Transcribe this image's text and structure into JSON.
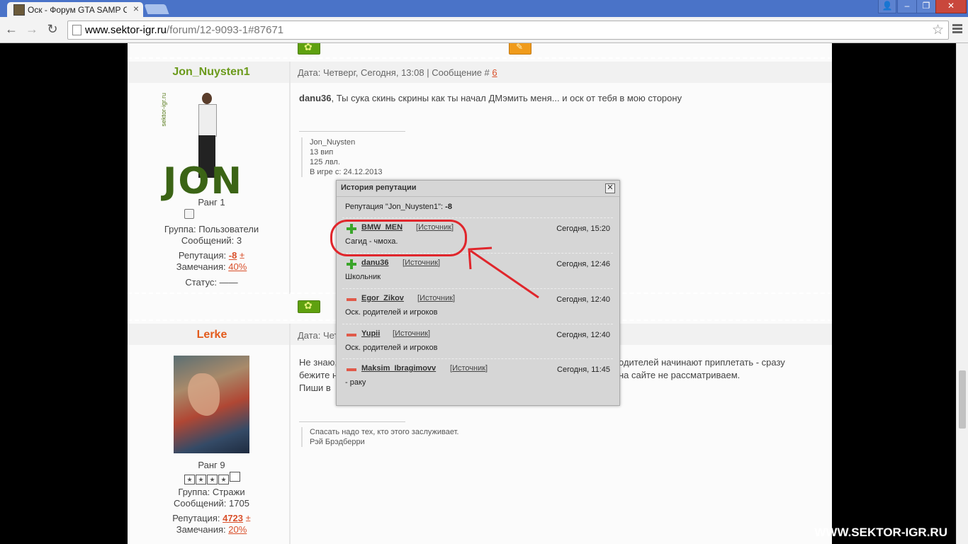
{
  "browser": {
    "tab_title": "Оск - Форум GTA SAMP С",
    "url_domain": "www.sektor-igr.ru",
    "url_path": "/forum/12-9093-1#87671"
  },
  "post1": {
    "username": "Jon_Nuysten1",
    "header": "Дата: Четверг, Сегодня, 13:08 | Сообщение # ",
    "post_number": "6",
    "avatar_side_text": "sektor-igr.ru",
    "avatar_logo": "JON",
    "rank": "Ранг 1",
    "group": "Группа: Пользователи",
    "messages": "Сообщений: 3",
    "rep_label": "Репутация: ",
    "rep_value": "-8",
    "rep_pm": "±",
    "warn_label": "Замечания: ",
    "warn_value": "40%",
    "status": "Статус: ——",
    "text_user": "danu36",
    "text": ", Ты сука скинь скрины как ты начал ДМэмить меня... и оск от тебя в мою сторону",
    "sig": [
      "Jon_Nuysten",
      "13 вип",
      "125 лвл.",
      "В игре с: 24.12.2013"
    ]
  },
  "post2": {
    "username": "Lerke",
    "header": "Дата: Чет",
    "rank": "Ранг 9",
    "group": "Группа: Стражи",
    "messages": "Сообщений: 1705",
    "rep_label": "Репутация: ",
    "rep_value": "4723",
    "rep_pm": "±",
    "warn_label": "Замечания: ",
    "warn_value": "20%",
    "text_line1_left": "Не знаю,",
    "text_line1_right": "одителей начинают приплетать - сразу",
    "text_line2_left": "бежите н",
    "text_line2_right": "на сайте не рассматриваем.",
    "text_line3_left": "Пиши в",
    "sig": [
      "Спасать надо тех, кто этого заслуживает.",
      "Рэй Брэдберри"
    ]
  },
  "popup": {
    "title": "История репутации",
    "close": "✕",
    "summary_label": "Репутация \"Jon_Nuysten1\": ",
    "summary_value": "-8",
    "entries": [
      {
        "sign": "plus",
        "name": "BMW_MEN",
        "source": "Источник",
        "time": "Сегодня, 15:20",
        "reason": "Сагид - чмоха."
      },
      {
        "sign": "plus",
        "name": "danu36",
        "source": "Источник",
        "time": "Сегодня, 12:46",
        "reason": "Школьник"
      },
      {
        "sign": "minus",
        "name": "Egor_Zikov",
        "source": "Источник",
        "time": "Сегодня, 12:40",
        "reason": "Оск. родителей и игроков"
      },
      {
        "sign": "minus",
        "name": "Yupii",
        "source": "Источник",
        "time": "Сегодня, 12:40",
        "reason": "Оск. родителей и игроков"
      },
      {
        "sign": "minus",
        "name": "Maksim_Ibragimovv",
        "source": "Источник",
        "time": "Сегодня, 11:45",
        "reason": "- раку"
      }
    ]
  },
  "watermark": "WWW.SEKTOR-IGR.RU",
  "colors": {
    "accent_orange": "#d9502b",
    "user_green": "#6b9a1b",
    "user_orange": "#e35b1c",
    "annotation_red": "#e0262c"
  }
}
